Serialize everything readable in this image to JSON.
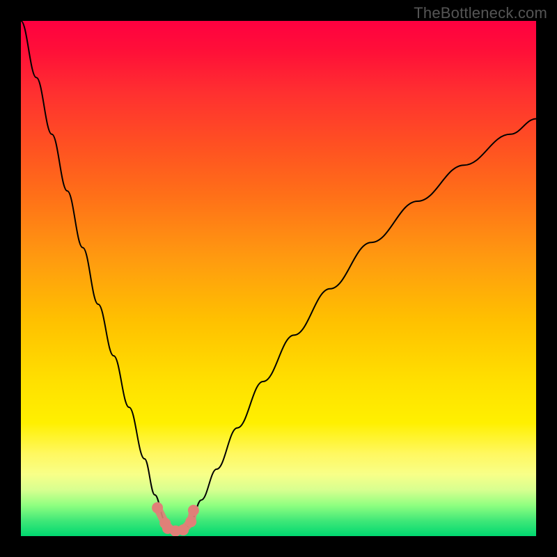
{
  "watermark": "TheBottleneck.com",
  "chart_data": {
    "type": "line",
    "title": "",
    "xlabel": "",
    "ylabel": "",
    "xlim": [
      0,
      100
    ],
    "ylim": [
      0,
      100
    ],
    "x": [
      0,
      3,
      6,
      9,
      12,
      15,
      18,
      21,
      24,
      26,
      28,
      29,
      30,
      31,
      32,
      33,
      35,
      38,
      42,
      47,
      53,
      60,
      68,
      77,
      86,
      95,
      100
    ],
    "values": [
      100,
      89,
      78,
      67,
      56,
      45,
      35,
      25,
      15,
      8,
      3,
      1,
      0.5,
      0.7,
      1.5,
      3,
      7,
      13,
      21,
      30,
      39,
      48,
      57,
      65,
      72,
      78,
      81
    ],
    "markers": {
      "x": [
        26.5,
        28.0,
        28.5,
        30.0,
        31.5,
        33.0,
        33.5
      ],
      "y": [
        5.5,
        2.5,
        1.5,
        1.0,
        1.2,
        2.8,
        5.0
      ],
      "color": "#e08078"
    },
    "background_gradient": {
      "type": "vertical",
      "stops": [
        {
          "pos": 0.0,
          "color": "#ff0040"
        },
        {
          "pos": 0.5,
          "color": "#ffb000"
        },
        {
          "pos": 0.78,
          "color": "#fff000"
        },
        {
          "pos": 1.0,
          "color": "#00d870"
        }
      ]
    }
  }
}
